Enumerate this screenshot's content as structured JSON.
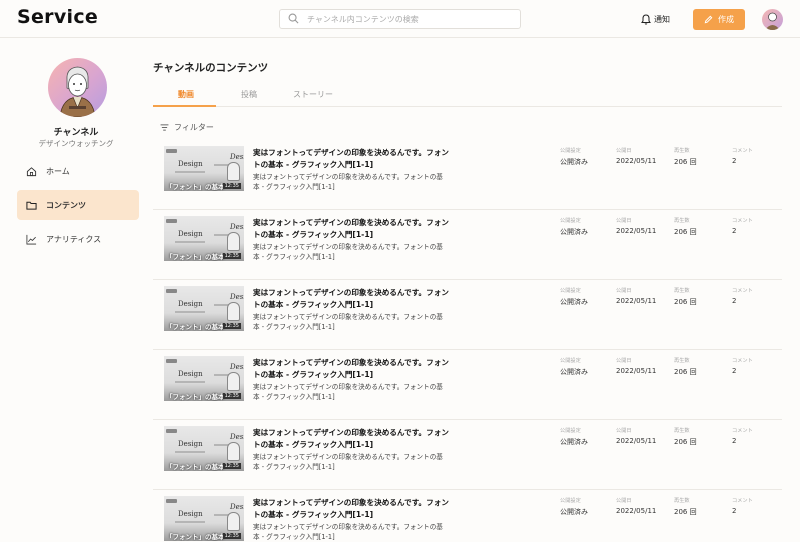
{
  "header": {
    "logo": "Service",
    "search_placeholder": "チャンネル内コンテンツの検索",
    "notifications_label": "通知",
    "create_label": "作成"
  },
  "sidebar": {
    "channel_name": "チャンネル",
    "channel_subtitle": "デザインウォッチング",
    "items": [
      {
        "label": "ホーム",
        "icon": "home-icon",
        "active": false
      },
      {
        "label": "コンテンツ",
        "icon": "folder-icon",
        "active": true
      },
      {
        "label": "アナリティクス",
        "icon": "analytics-icon",
        "active": false
      }
    ]
  },
  "main": {
    "title": "チャンネルのコンテンツ",
    "tabs": [
      {
        "label": "動画",
        "active": true
      },
      {
        "label": "投稿",
        "active": false
      },
      {
        "label": "ストーリー",
        "active": false
      }
    ],
    "filter_label": "フィルター",
    "columns": {
      "visibility": "公開設定",
      "date": "公開日",
      "views": "再生数",
      "comments": "コメント"
    },
    "thumbnail": {
      "title_left": "Design",
      "title_right": "Desig",
      "caption": "「フォント」の基本",
      "duration": "12:35"
    },
    "rows": [
      {
        "title": "実はフォントってデザインの印象を決めるんです。フォントの基本 - グラフィック入門[1-1]",
        "description": "実はフォントってデザインの印象を決めるんです。フォントの基本 - グラフィック入門[1-1]",
        "visibility": "公開済み",
        "date": "2022/05/11",
        "views": "206 回",
        "comments": "2"
      },
      {
        "title": "実はフォントってデザインの印象を決めるんです。フォントの基本 - グラフィック入門[1-1]",
        "description": "実はフォントってデザインの印象を決めるんです。フォントの基本 - グラフィック入門[1-1]",
        "visibility": "公開済み",
        "date": "2022/05/11",
        "views": "206 回",
        "comments": "2"
      },
      {
        "title": "実はフォントってデザインの印象を決めるんです。フォントの基本 - グラフィック入門[1-1]",
        "description": "実はフォントってデザインの印象を決めるんです。フォントの基本 - グラフィック入門[1-1]",
        "visibility": "公開済み",
        "date": "2022/05/11",
        "views": "206 回",
        "comments": "2"
      },
      {
        "title": "実はフォントってデザインの印象を決めるんです。フォントの基本 - グラフィック入門[1-1]",
        "description": "実はフォントってデザインの印象を決めるんです。フォントの基本 - グラフィック入門[1-1]",
        "visibility": "公開済み",
        "date": "2022/05/11",
        "views": "206 回",
        "comments": "2"
      },
      {
        "title": "実はフォントってデザインの印象を決めるんです。フォントの基本 - グラフィック入門[1-1]",
        "description": "実はフォントってデザインの印象を決めるんです。フォントの基本 - グラフィック入門[1-1]",
        "visibility": "公開済み",
        "date": "2022/05/11",
        "views": "206 回",
        "comments": "2"
      },
      {
        "title": "実はフォントってデザインの印象を決めるんです。フォントの基本 - グラフィック入門[1-1]",
        "description": "実はフォントってデザインの印象を決めるんです。フォントの基本 - グラフィック入門[1-1]",
        "visibility": "公開済み",
        "date": "2022/05/11",
        "views": "206 回",
        "comments": "2"
      }
    ]
  },
  "colors": {
    "accent": "#f5a14a",
    "accent_text": "#f08a2e",
    "nav_active_bg": "#fbe5cd"
  }
}
